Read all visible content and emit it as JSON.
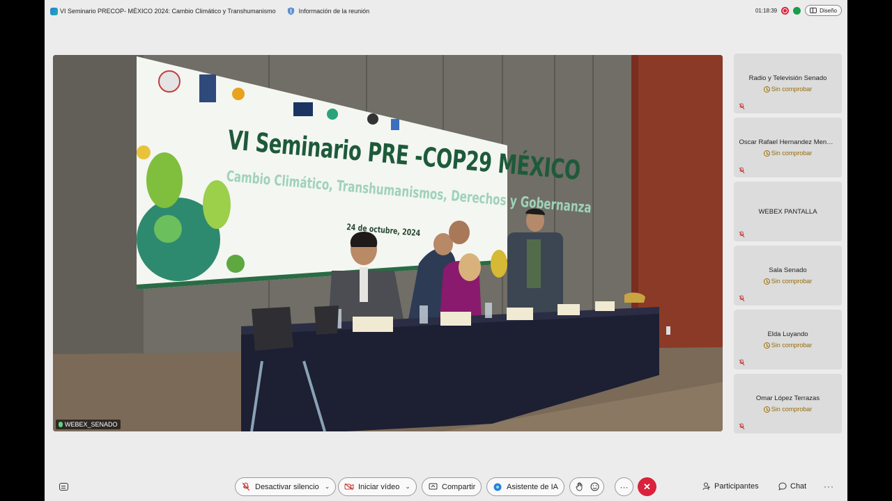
{
  "titlebar": {
    "meeting_title": "VI Seminario PRECOP- MÉXICO 2024: Cambio Climático y Transhumanismo",
    "meeting_info": "Información de la reunión",
    "timer": "01:18:39",
    "layout_label": "Diseño"
  },
  "stage": {
    "label": "WEBEX_SENADO",
    "banner_title": "VI Seminario PRE -COP29 MÉXICO",
    "banner_subtitle": "Cambio Climático, Transhumanismos, Derechos y Gobernanza",
    "banner_date": "24 de octubre, 2024"
  },
  "participants": [
    {
      "name": "Radio y Televisión Senado",
      "status": "Sin comprobar"
    },
    {
      "name": "Oscar Rafael Hernandez Meneses",
      "status": "Sin comprobar"
    },
    {
      "name": "WEBEX PANTALLA",
      "status": ""
    },
    {
      "name": "Sala Senado",
      "status": "Sin comprobar"
    },
    {
      "name": "Elda Luyando",
      "status": "Sin comprobar"
    },
    {
      "name": "Omar López Terrazas",
      "status": "Sin comprobar"
    }
  ],
  "toolbar": {
    "mute_label": "Desactivar silencio",
    "video_label": "Iniciar vídeo",
    "share_label": "Compartir",
    "ai_label": "Asistente de IA",
    "more": "···",
    "leave": "✕",
    "participants_label": "Participantes",
    "chat_label": "Chat",
    "more_right": "···"
  },
  "colors": {
    "leave_red": "#d9223b",
    "status_amber": "#9a6a00",
    "accent_blue": "#2a7de1"
  },
  "icons": [
    "app-logo-icon",
    "shield-icon",
    "record-icon",
    "signal-icon",
    "layout-icon",
    "clock-icon",
    "mic-muted-icon",
    "captions-icon",
    "camera-off-icon",
    "share-icon",
    "ai-icon",
    "hand-icon",
    "emoji-icon",
    "person-icon",
    "chat-icon"
  ]
}
